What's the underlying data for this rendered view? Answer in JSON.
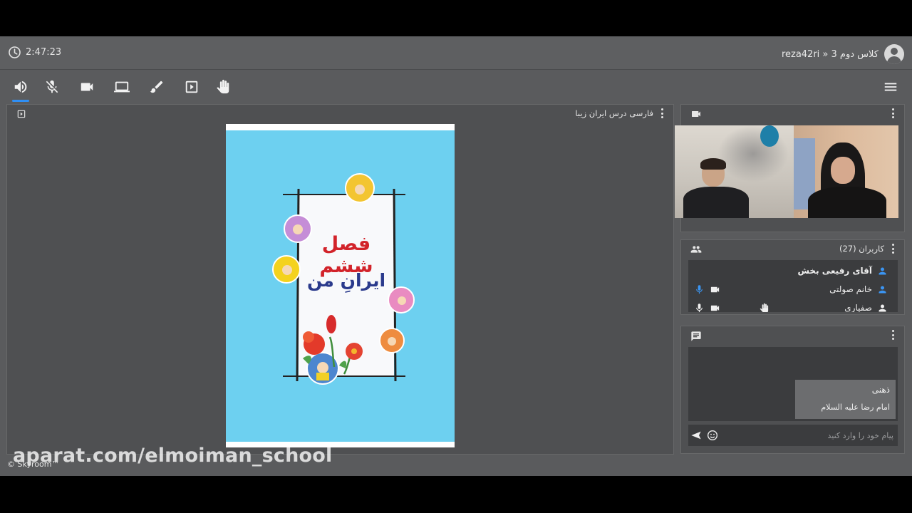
{
  "header": {
    "timer": "2:47:23",
    "breadcrumb": "reza42ri » کلاس دوم 3"
  },
  "toolbar": {
    "items": [
      "speaker-icon",
      "mic-off-icon",
      "camera-icon",
      "screen-share-icon",
      "brush-icon",
      "play-box-icon",
      "raise-hand-icon"
    ],
    "menu": "hamburger-menu-icon",
    "accent": "#2f8ff5"
  },
  "presentation": {
    "title": "فارسی درس ایران زیبا",
    "slide": {
      "heading": "فصل ششم",
      "subheading": "ایرانِ من",
      "heading_color": "#d2232a",
      "subheading_color": "#2a3a8c",
      "background": "#6dd0f0"
    }
  },
  "users": {
    "title": "کاربران (27)",
    "list": [
      {
        "name": "آقای رفیعی بخش",
        "bold": true
      },
      {
        "name": "خانم صولتی",
        "bold": false
      },
      {
        "name": "صفیاری",
        "bold": false
      }
    ]
  },
  "chat": {
    "messages": [
      {
        "author": "ذهنی",
        "text": "امام رضا علیه السلام"
      }
    ],
    "placeholder": "پیام خود را وارد کنید"
  },
  "footer": {
    "watermark": "aparat.com/elmoiman_school",
    "brand": "© Skyroom™"
  }
}
